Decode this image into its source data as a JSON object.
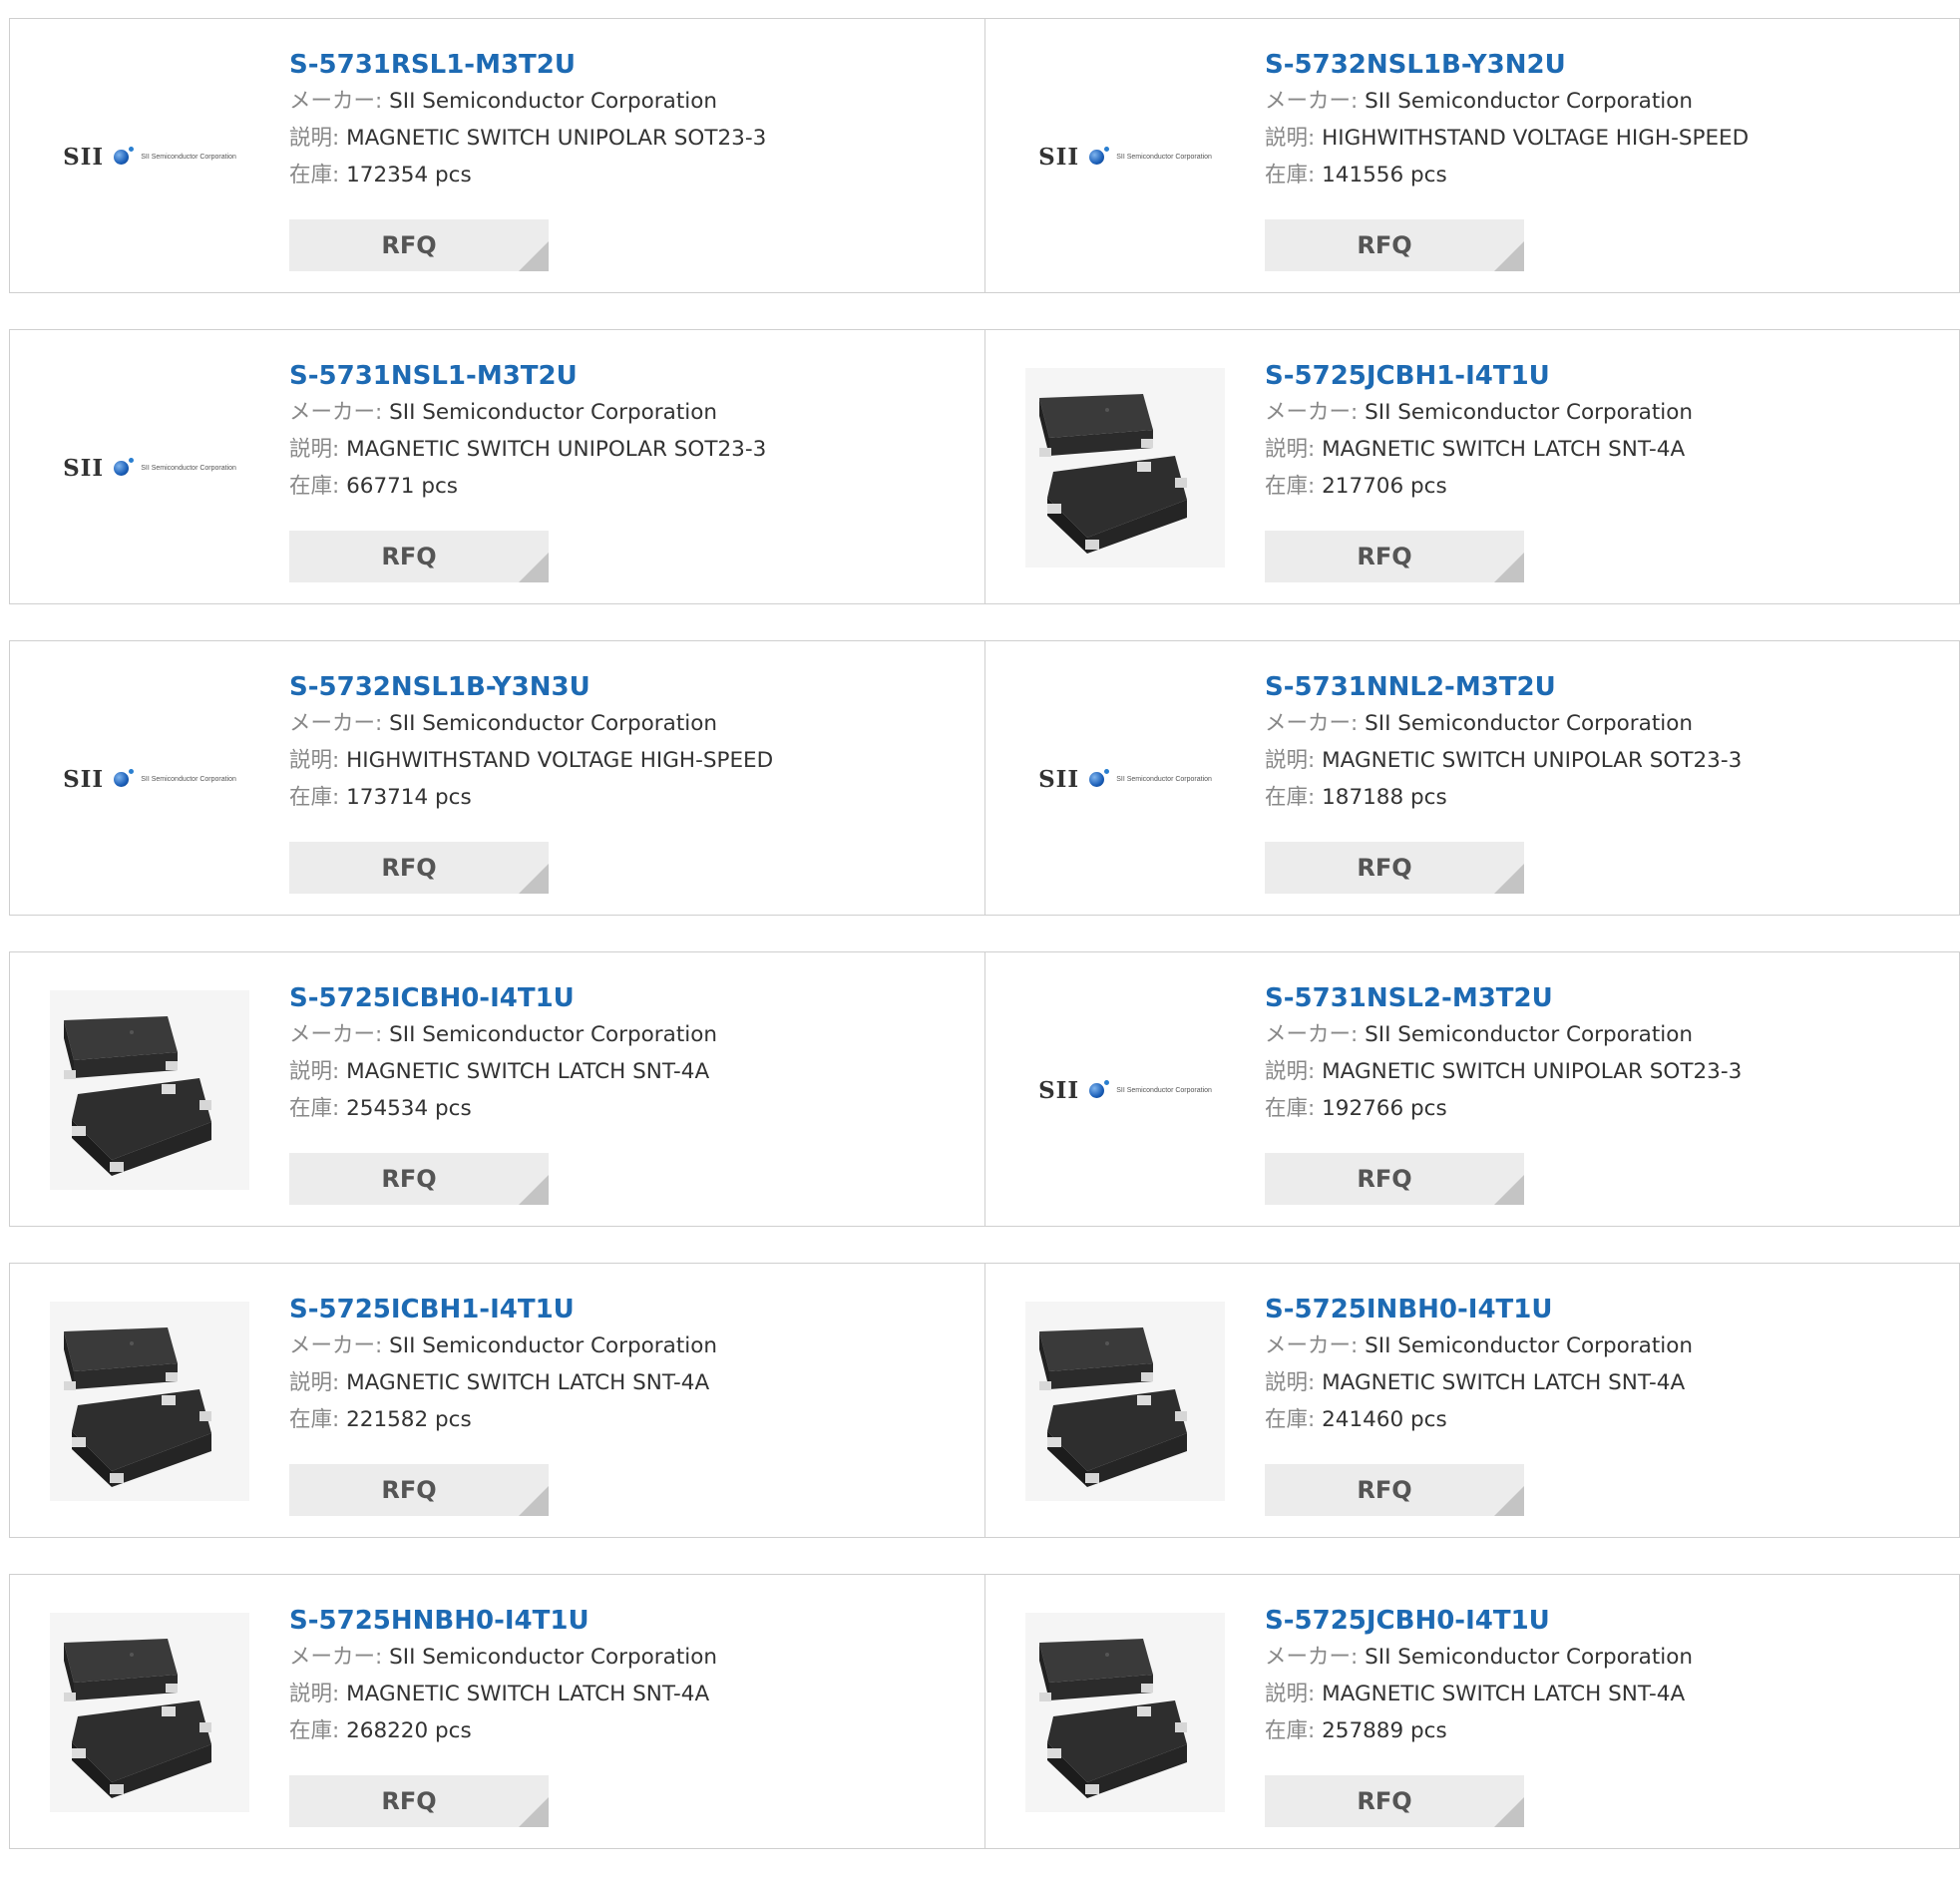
{
  "labels": {
    "maker": "メーカー:",
    "description": "説明:",
    "stock": "在庫:",
    "rfq": "RFQ"
  },
  "logo": {
    "text": "SII",
    "subtext": "SII Semiconductor Corporation"
  },
  "products": [
    {
      "part": "S-5731RSL1-M3T2U",
      "maker": "SII Semiconductor Corporation",
      "description": "MAGNETIC SWITCH UNIPOLAR SOT23-3",
      "stock": "172354 pcs",
      "image": "sii-logo"
    },
    {
      "part": "S-5732NSL1B-Y3N2U",
      "maker": "SII Semiconductor Corporation",
      "description": "HIGHWITHSTAND VOLTAGE HIGH-SPEED",
      "stock": "141556 pcs",
      "image": "sii-logo"
    },
    {
      "part": "S-5731NSL1-M3T2U",
      "maker": "SII Semiconductor Corporation",
      "description": "MAGNETIC SWITCH UNIPOLAR SOT23-3",
      "stock": "66771 pcs",
      "image": "sii-logo"
    },
    {
      "part": "S-5725JCBH1-I4T1U",
      "maker": "SII Semiconductor Corporation",
      "description": "MAGNETIC SWITCH LATCH SNT-4A",
      "stock": "217706 pcs",
      "image": "chip-photo"
    },
    {
      "part": "S-5732NSL1B-Y3N3U",
      "maker": "SII Semiconductor Corporation",
      "description": "HIGHWITHSTAND VOLTAGE HIGH-SPEED",
      "stock": "173714 pcs",
      "image": "sii-logo"
    },
    {
      "part": "S-5731NNL2-M3T2U",
      "maker": "SII Semiconductor Corporation",
      "description": "MAGNETIC SWITCH UNIPOLAR SOT23-3",
      "stock": "187188 pcs",
      "image": "sii-logo"
    },
    {
      "part": "S-5725ICBH0-I4T1U",
      "maker": "SII Semiconductor Corporation",
      "description": "MAGNETIC SWITCH LATCH SNT-4A",
      "stock": "254534 pcs",
      "image": "chip-photo"
    },
    {
      "part": "S-5731NSL2-M3T2U",
      "maker": "SII Semiconductor Corporation",
      "description": "MAGNETIC SWITCH UNIPOLAR SOT23-3",
      "stock": "192766 pcs",
      "image": "sii-logo"
    },
    {
      "part": "S-5725ICBH1-I4T1U",
      "maker": "SII Semiconductor Corporation",
      "description": "MAGNETIC SWITCH LATCH SNT-4A",
      "stock": "221582 pcs",
      "image": "chip-photo"
    },
    {
      "part": "S-5725INBH0-I4T1U",
      "maker": "SII Semiconductor Corporation",
      "description": "MAGNETIC SWITCH LATCH SNT-4A",
      "stock": "241460 pcs",
      "image": "chip-photo"
    },
    {
      "part": "S-5725HNBH0-I4T1U",
      "maker": "SII Semiconductor Corporation",
      "description": "MAGNETIC SWITCH LATCH SNT-4A",
      "stock": "268220 pcs",
      "image": "chip-photo"
    },
    {
      "part": "S-5725JCBH0-I4T1U",
      "maker": "SII Semiconductor Corporation",
      "description": "MAGNETIC SWITCH LATCH SNT-4A",
      "stock": "257889 pcs",
      "image": "chip-photo"
    }
  ],
  "colors": {
    "part_link": "#1d6ab3",
    "border": "#cfcfcf",
    "rfq_bg": "#ececec"
  }
}
